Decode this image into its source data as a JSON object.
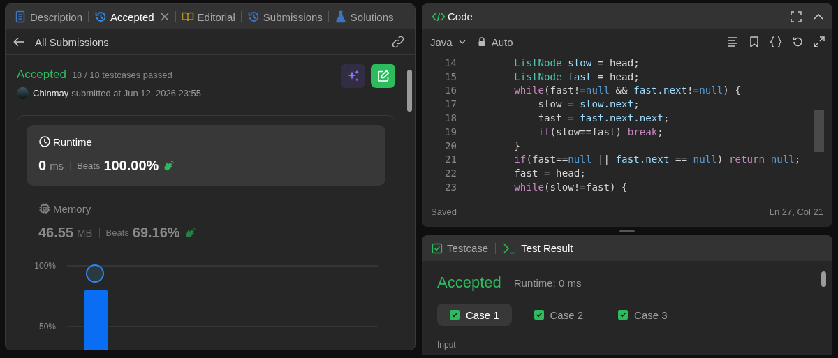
{
  "problem_tabs": [
    {
      "label": "Description",
      "kind": "doc",
      "selected": false,
      "closable": false
    },
    {
      "label": "Accepted",
      "kind": "history",
      "selected": true,
      "closable": true
    },
    {
      "label": "Editorial",
      "kind": "book",
      "selected": false,
      "closable": false
    },
    {
      "label": "Submissions",
      "kind": "history",
      "selected": false,
      "closable": false
    },
    {
      "label": "Solutions",
      "kind": "flask",
      "selected": false,
      "closable": false
    }
  ],
  "submission_header": {
    "back_label": "All Submissions"
  },
  "result": {
    "status": "Accepted",
    "testcases": "18 / 18 testcases passed",
    "user": "Chinmay",
    "submitted": "submitted at Jun 12, 2026 23:55"
  },
  "stats": [
    {
      "kind": "clock",
      "title": "Runtime",
      "value": "0",
      "unit": "ms",
      "beats_label": "Beats",
      "beats": "100.00%",
      "selected": true
    },
    {
      "kind": "chip",
      "title": "Memory",
      "value": "46.55",
      "unit": "MB",
      "beats_label": "Beats",
      "beats": "69.16%",
      "selected": false
    }
  ],
  "chart_data": {
    "type": "bar",
    "values": [
      80
    ],
    "ylim": [
      0,
      100
    ],
    "yticks": [
      {
        "value": 50,
        "label": "50%"
      },
      {
        "value": 100,
        "label": "100%"
      }
    ]
  },
  "code_panel": {
    "title": "Code",
    "language": "Java",
    "mode": "Auto",
    "lines": [
      {
        "number": "14",
        "tokens": [
          {
            "text": "        ListNode",
            "kind": "type"
          },
          {
            "text": " slow",
            "kind": "var"
          },
          {
            "text": " = head;",
            "kind": "plain"
          }
        ]
      },
      {
        "number": "15",
        "tokens": [
          {
            "text": "        ListNode",
            "kind": "type"
          },
          {
            "text": " fast",
            "kind": "var"
          },
          {
            "text": " = head;",
            "kind": "plain"
          }
        ]
      },
      {
        "number": "16",
        "tokens": [
          {
            "text": "        while",
            "kind": "kw"
          },
          {
            "text": "(fast!=",
            "kind": "plain"
          },
          {
            "text": "null",
            "kind": "const"
          },
          {
            "text": " && ",
            "kind": "plain"
          },
          {
            "text": "fast.next",
            "kind": "var"
          },
          {
            "text": "!=",
            "kind": "plain"
          },
          {
            "text": "null",
            "kind": "const"
          },
          {
            "text": ") {",
            "kind": "plain"
          }
        ]
      },
      {
        "number": "17",
        "tokens": [
          {
            "text": "            slow = ",
            "kind": "plain"
          },
          {
            "text": "slow.next",
            "kind": "var"
          },
          {
            "text": ";",
            "kind": "plain"
          }
        ]
      },
      {
        "number": "18",
        "tokens": [
          {
            "text": "            fast = ",
            "kind": "plain"
          },
          {
            "text": "fast.next.next",
            "kind": "var"
          },
          {
            "text": ";",
            "kind": "plain"
          }
        ]
      },
      {
        "number": "19",
        "tokens": [
          {
            "text": "            if",
            "kind": "kw"
          },
          {
            "text": "(slow==fast) ",
            "kind": "plain"
          },
          {
            "text": "break",
            "kind": "kw"
          },
          {
            "text": ";",
            "kind": "plain"
          }
        ]
      },
      {
        "number": "20",
        "tokens": [
          {
            "text": "        }",
            "kind": "plain"
          }
        ]
      },
      {
        "number": "21",
        "tokens": [
          {
            "text": "        if",
            "kind": "kw"
          },
          {
            "text": "(fast==",
            "kind": "plain"
          },
          {
            "text": "null",
            "kind": "const"
          },
          {
            "text": " || ",
            "kind": "plain"
          },
          {
            "text": "fast.next",
            "kind": "var"
          },
          {
            "text": " == ",
            "kind": "plain"
          },
          {
            "text": "null",
            "kind": "const"
          },
          {
            "text": ") ",
            "kind": "plain"
          },
          {
            "text": "return",
            "kind": "kw"
          },
          {
            "text": " null",
            "kind": "const"
          },
          {
            "text": ";",
            "kind": "plain"
          }
        ]
      },
      {
        "number": "22",
        "tokens": [
          {
            "text": "        fast = head;",
            "kind": "plain"
          }
        ]
      },
      {
        "number": "23",
        "tokens": [
          {
            "text": "        while",
            "kind": "kw"
          },
          {
            "text": "(slow!=fast) {",
            "kind": "plain"
          }
        ]
      }
    ],
    "status": "Saved",
    "cursor": "Ln 27, Col 21"
  },
  "result_panel": {
    "tabs": [
      {
        "label": "Testcase",
        "kind": "check",
        "selected": false
      },
      {
        "label": "Test Result",
        "kind": "terminal",
        "selected": true
      }
    ],
    "status": "Accepted",
    "runtime": "Runtime: 0 ms",
    "cases": [
      {
        "label": "Case 1",
        "selected": true,
        "passed": true
      },
      {
        "label": "Case 2",
        "selected": false,
        "passed": true
      },
      {
        "label": "Case 3",
        "selected": false,
        "passed": true
      }
    ],
    "input_label": "Input"
  }
}
